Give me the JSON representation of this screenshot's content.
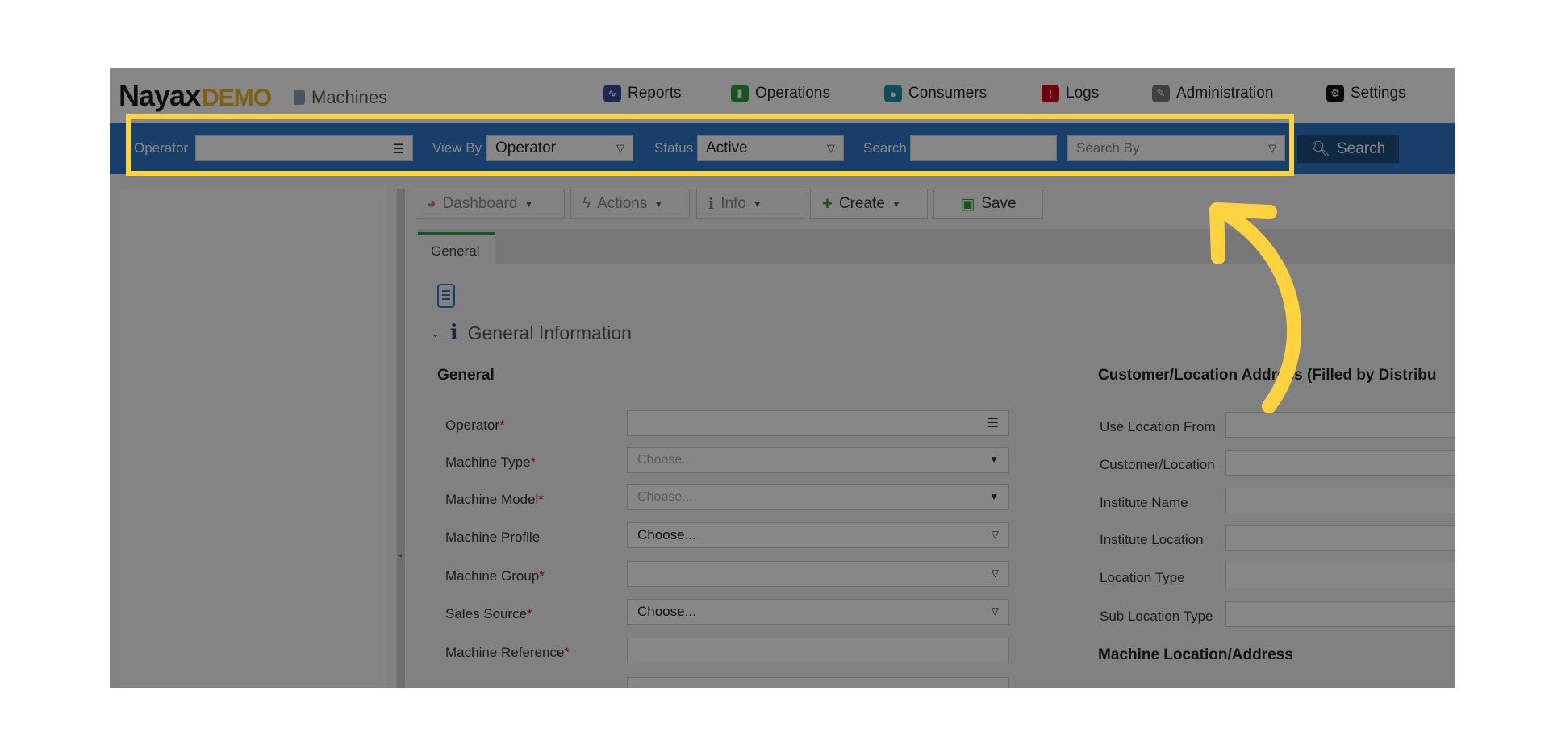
{
  "brand": {
    "logo_main": "Nayax",
    "logo_demo": "DEMO",
    "app_name": "Machines"
  },
  "nav": [
    {
      "label": "Reports",
      "icon": "chart-icon",
      "color": "#3c4d9e"
    },
    {
      "label": "Operations",
      "icon": "operations-icon",
      "color": "#2e9b3c"
    },
    {
      "label": "Consumers",
      "icon": "consumers-icon",
      "color": "#1f8fa8"
    },
    {
      "label": "Logs",
      "icon": "logs-icon",
      "color": "#d0021b"
    },
    {
      "label": "Administration",
      "icon": "administration-icon",
      "color": "#777777"
    },
    {
      "label": "Settings",
      "icon": "settings-icon",
      "color": "#111111"
    }
  ],
  "filterbar": {
    "operator_label": "Operator",
    "operator_value": "",
    "viewby_label": "View By",
    "viewby_value": "Operator",
    "status_label": "Status",
    "status_value": "Active",
    "search_label": "Search",
    "search_value": "",
    "searchby_placeholder": "Search By",
    "search_button": "Search",
    "bar_color": "#2f78c8"
  },
  "toolbar": {
    "dashboard": "Dashboard",
    "actions": "Actions",
    "info": "Info",
    "create": "Create",
    "save": "Save"
  },
  "tabs": [
    {
      "label": "General",
      "active": true
    }
  ],
  "section": {
    "title": "General Information"
  },
  "general": {
    "heading": "General",
    "fields": [
      {
        "label": "Operator",
        "required": true,
        "value": "",
        "placeholder": "",
        "control": "list"
      },
      {
        "label": "Machine Type",
        "required": true,
        "value": "",
        "placeholder": "Choose...",
        "control": "dropdown"
      },
      {
        "label": "Machine Model",
        "required": true,
        "value": "",
        "placeholder": "Choose...",
        "control": "dropdown"
      },
      {
        "label": "Machine Profile",
        "required": false,
        "value": "Choose...",
        "placeholder": "",
        "control": "select"
      },
      {
        "label": "Machine Group",
        "required": true,
        "value": "",
        "placeholder": "",
        "control": "select"
      },
      {
        "label": "Sales Source",
        "required": true,
        "value": "Choose...",
        "placeholder": "",
        "control": "select"
      },
      {
        "label": "Machine Reference",
        "required": true,
        "value": "",
        "placeholder": "",
        "control": "text"
      }
    ]
  },
  "customer": {
    "heading": "Customer/Location Address (Filled by Distribu",
    "fields": [
      "Use Location From",
      "Customer/Location",
      "Institute Name",
      "Institute Location",
      "Location Type",
      "Sub Location Type"
    ],
    "machine_location_heading": "Machine Location/Address"
  },
  "overlay": {
    "highlight_color": "#ffd23f"
  }
}
